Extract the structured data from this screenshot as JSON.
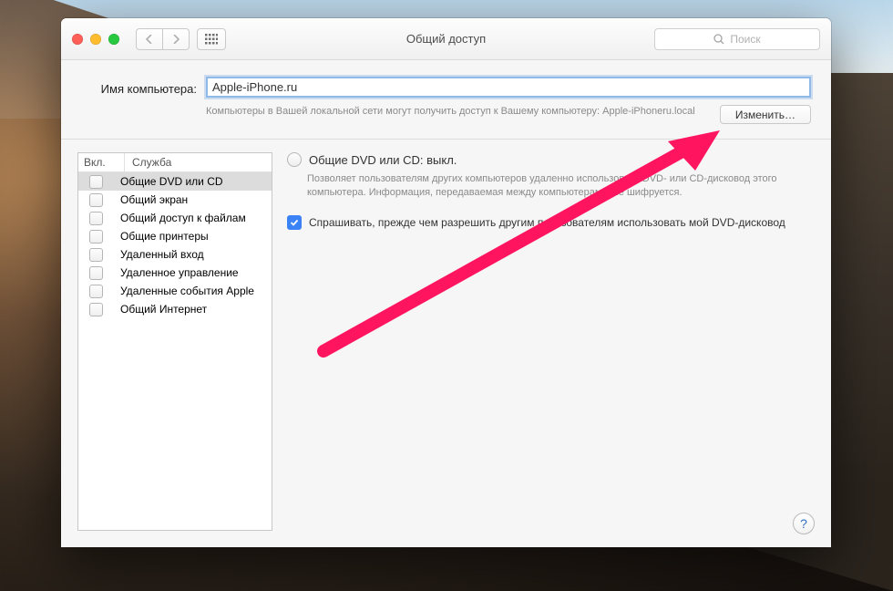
{
  "window_title": "Общий доступ",
  "search_placeholder": "Поиск",
  "header": {
    "computer_name_label": "Имя компьютера:",
    "computer_name_value": "Apple-iPhone.ru",
    "subtext": "Компьютеры в Вашей локальной сети могут получить доступ к Вашему компьютеру: Apple-iPhoneru.local",
    "edit_button": "Изменить…"
  },
  "services": {
    "col_on": "Вкл.",
    "col_service": "Служба",
    "items": [
      {
        "label": "Общие DVD или CD",
        "checked": false,
        "selected": true
      },
      {
        "label": "Общий экран",
        "checked": false,
        "selected": false
      },
      {
        "label": "Общий доступ к файлам",
        "checked": false,
        "selected": false
      },
      {
        "label": "Общие принтеры",
        "checked": false,
        "selected": false
      },
      {
        "label": "Удаленный вход",
        "checked": false,
        "selected": false
      },
      {
        "label": "Удаленное управление",
        "checked": false,
        "selected": false
      },
      {
        "label": "Удаленные события Apple",
        "checked": false,
        "selected": false
      },
      {
        "label": "Общий Интернет",
        "checked": false,
        "selected": false
      }
    ]
  },
  "detail": {
    "title": "Общие DVD или CD: выкл.",
    "description": "Позволяет пользователям других компьютеров удаленно использовать DVD- или CD-дисковод этого компьютера. Информация, передаваемая между компьютерами, не шифруется.",
    "ask_permission_checked": true,
    "ask_permission_label": "Спрашивать, прежде чем разрешить другим пользователям использовать мой DVD-дисковод"
  }
}
